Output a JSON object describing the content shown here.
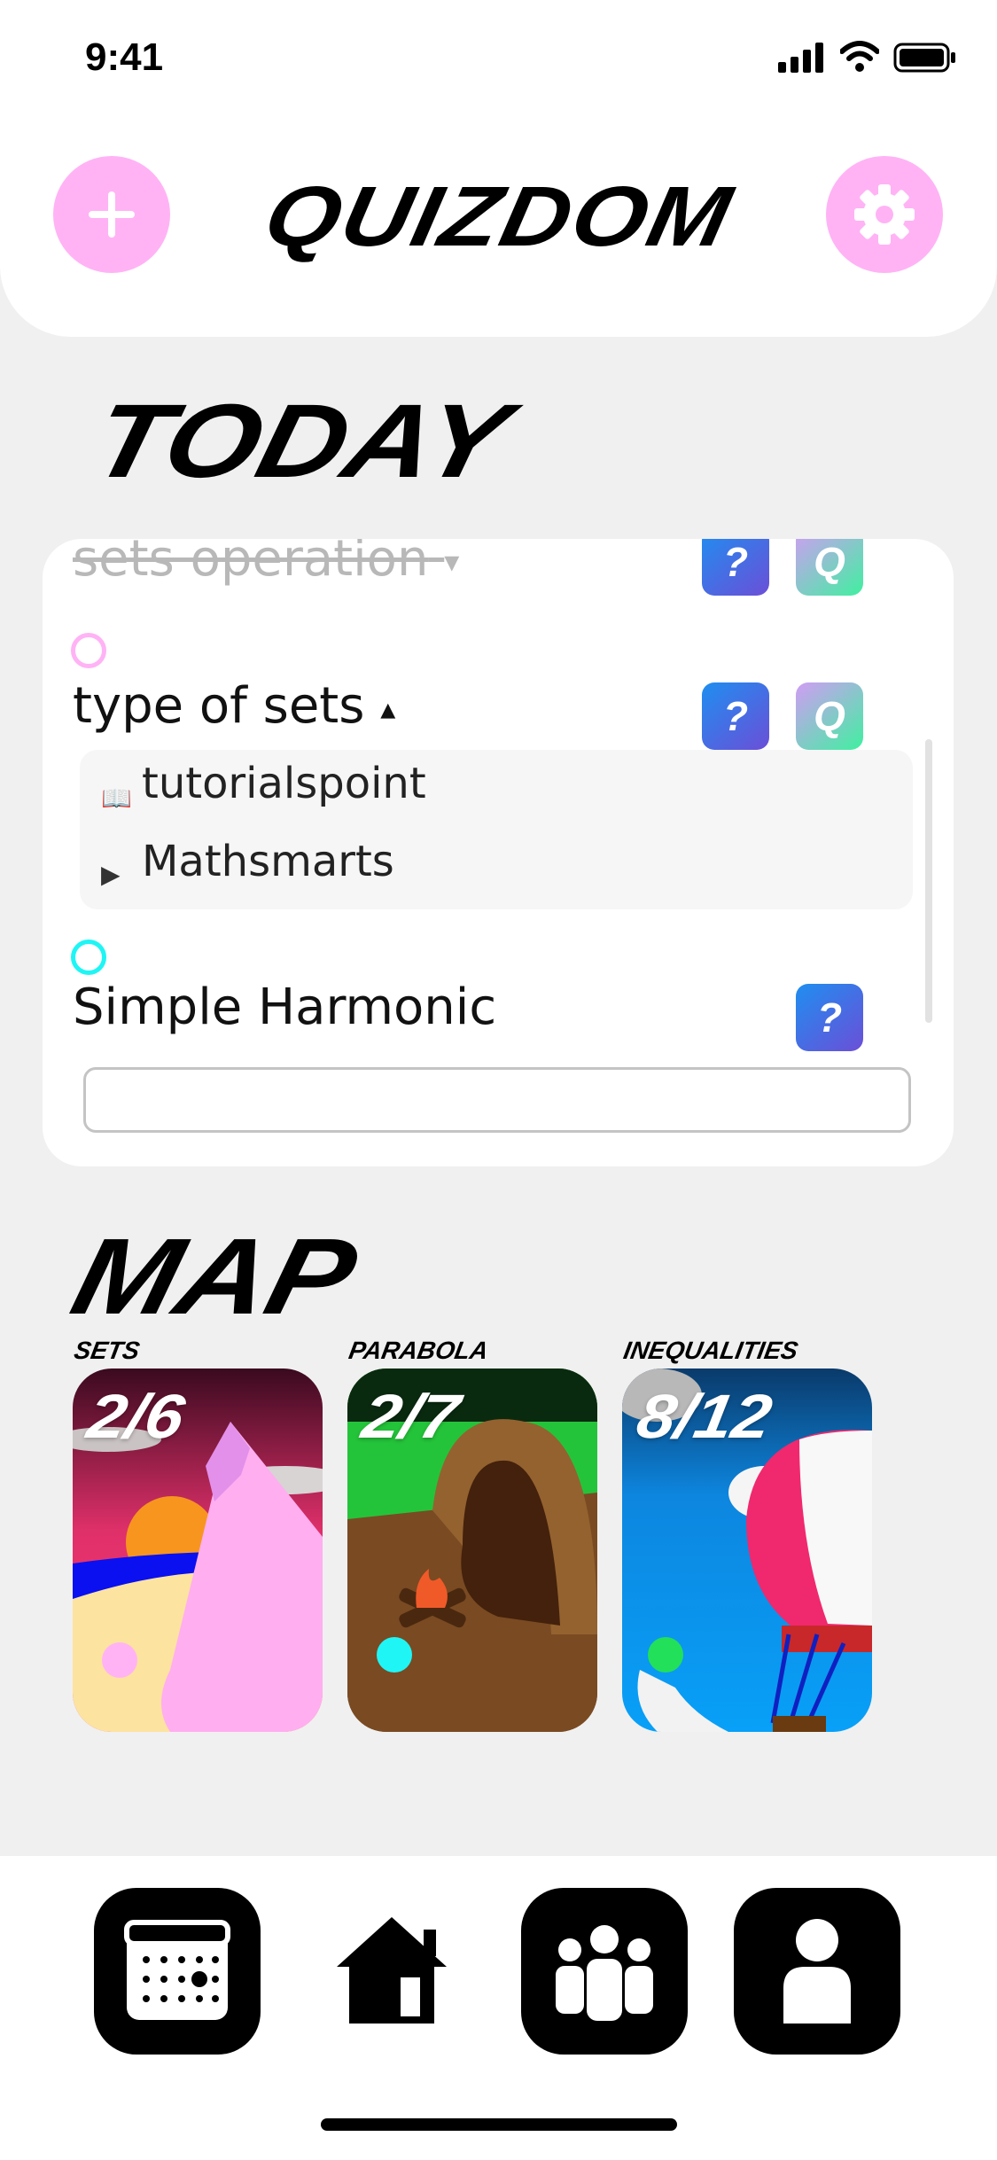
{
  "status_bar": {
    "time": "9:41"
  },
  "header": {
    "title": "QUIZDOM",
    "add_icon": "plus-icon",
    "settings_icon": "gear-icon",
    "accent_color": "#ffb3f5"
  },
  "today": {
    "heading": "TODAY",
    "topics": [
      {
        "label": "sets operation",
        "completed": true,
        "expanded": false,
        "toggle": "▾",
        "dot_color": "#ffb3f5",
        "buttons": [
          "quiz-question-icon",
          "quiz-q-icon"
        ]
      },
      {
        "label": "type of sets",
        "completed": false,
        "expanded": true,
        "toggle": "▴",
        "dot_color": "#ffb3f5",
        "buttons": [
          "quiz-question-icon",
          "quiz-q-icon"
        ],
        "resources": [
          {
            "icon": "book-icon",
            "glyph": "📖",
            "label": "tutorialspoint"
          },
          {
            "icon": "play-icon",
            "glyph": "▶",
            "label": "Mathsmarts"
          }
        ]
      },
      {
        "label": "Simple Harmonic",
        "completed": false,
        "expanded": false,
        "dot_color": "#1ff5f5",
        "buttons": [
          "quiz-question-icon"
        ]
      }
    ],
    "note_input": {
      "value": "",
      "placeholder": ""
    }
  },
  "map": {
    "heading": "MAP",
    "cards": [
      {
        "label": "SETS",
        "progress": "2/6",
        "dot_color": "#ffb3f5"
      },
      {
        "label": "PARABOLA",
        "progress": "2/7",
        "dot_color": "#1ff5f5"
      },
      {
        "label": "INEQUALITIES",
        "progress": "8/12",
        "dot_color": "#22e05a"
      }
    ]
  },
  "tabbar": {
    "tabs": [
      {
        "icon": "calendar-icon",
        "active": false
      },
      {
        "icon": "home-icon",
        "active": true
      },
      {
        "icon": "groups-icon",
        "active": false
      },
      {
        "icon": "profile-icon",
        "active": false
      }
    ]
  },
  "colors": {
    "background": "#f0f0f0",
    "card": "#ffffff",
    "accent_pink": "#ffb3f5",
    "accent_cyan": "#1ff5f5",
    "accent_green": "#22e05a"
  }
}
